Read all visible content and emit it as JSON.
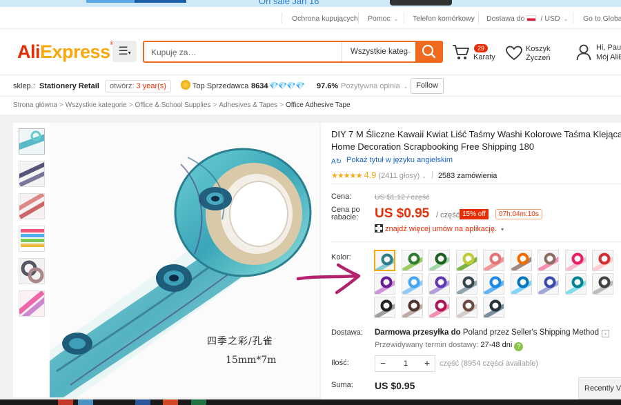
{
  "banner": {
    "text": "On sale Jan 16"
  },
  "topbar": {
    "links": [
      "Ochrona kupujących",
      "Pomoc",
      "Telefon komórkowy",
      "Dostawa do",
      "USD",
      "Go to Global"
    ],
    "separator": "/"
  },
  "header": {
    "logo_ali": "Ali",
    "logo_express": "Express",
    "logo_tm": "®",
    "search_placeholder": "Kupuję za…",
    "search_category": "Wszystkie kateg",
    "cart_count": "29",
    "cart_label": "Karaty",
    "wishlist_line1": "Koszyk",
    "wishlist_line2": "Życzeń",
    "user_line1": "Hi, Paul",
    "user_line2": "Mój AliE"
  },
  "store": {
    "label": "sklep.:",
    "name": "Stationery Retail",
    "open_label": "otwórz:",
    "open_value": "3 year(s)",
    "top_seller": "Top Sprzedawca",
    "score": "8634",
    "diamonds": "💎💎💎💎",
    "positive_pct": "97.6%",
    "positive_label": "Pozytywna opinia",
    "follow": "Follow"
  },
  "breadcrumbs": [
    "Strona główna",
    "Wszystkie kategorie",
    "Office & School Supplies",
    "Adhesives & Tapes",
    "Office Adhesive Tape"
  ],
  "product": {
    "title_line1": "DIY 7 M Śliczne Kawaii Kwiat Liść Taśmy Washi Kolorowe Taśma Klejąca D",
    "title_line2": "Home Decoration Scrapbooking Free Shipping 180",
    "translate": "Pokaż tytuł w języku angielskim",
    "stars": "★★★★★",
    "rating": "4.9",
    "votes": "(2411 głosy)",
    "orders": "2583 zamówienia",
    "price_label": "Cena:",
    "old_price": "US $1.12 / część",
    "discount_label_1": "Cena po",
    "discount_label_2": "rabacie:",
    "price": "US $0.95",
    "per_piece": "/ część",
    "off": "15% off",
    "timer": "07h:04m:10s",
    "app_deals": "znajdź więcej umów na aplikację.",
    "color_label": "Kolor:",
    "shipping_label": "Dostawa:",
    "shipping_bold": "Darmowa przesyłka do",
    "shipping_rest": "Poland przez Seller's Shipping Method",
    "delivery_label": "Przewidywany termin dostawy:",
    "delivery_days": "27-48 dni",
    "qty_label": "Ilość:",
    "qty_minus": "−",
    "qty_value": "1",
    "qty_plus": "+",
    "qty_info": "część (8954 części available)",
    "total_label": "Suma:",
    "total": "US $0.95",
    "image_text_1": "四季之彩/孔雀",
    "image_text_2": "15mm*7m"
  },
  "recently_viewed": "Recently V",
  "colors": {
    "brand_red": "#e62e04",
    "brand_orange": "#f7a80e",
    "search_orange": "#f06a1e",
    "arrow": "#b3236e"
  },
  "swatches": [
    {
      "c1": "#2f7d8a",
      "c2": "#89c9d2"
    },
    {
      "c1": "#2e7d32",
      "c2": "#9ccc65"
    },
    {
      "c1": "#1b5e20",
      "c2": "#a5d6a7"
    },
    {
      "c1": "#c0ca33",
      "c2": "#7cb342"
    },
    {
      "c1": "#e57373",
      "c2": "#ef9a9a"
    },
    {
      "c1": "#ef6c00",
      "c2": "#a1887f"
    },
    {
      "c1": "#8d6e63",
      "c2": "#f48fb1"
    },
    {
      "c1": "#e91e63",
      "c2": "#f8bbd0"
    },
    {
      "c1": "#d32f2f",
      "c2": "#ffcdd2"
    },
    {
      "c1": "#6a1b9a",
      "c2": "#ce93d8"
    },
    {
      "c1": "#42a5f5",
      "c2": "#90caf9"
    },
    {
      "c1": "#5e35b1",
      "c2": "#b39ddb"
    },
    {
      "c1": "#37474f",
      "c2": "#90a4ae"
    },
    {
      "c1": "#1e88e5",
      "c2": "#64b5f6"
    },
    {
      "c1": "#0277bd",
      "c2": "#81d4fa"
    },
    {
      "c1": "#3949ab",
      "c2": "#9fa8da"
    },
    {
      "c1": "#00838f",
      "c2": "#80deea"
    },
    {
      "c1": "#424242",
      "c2": "#bdbdbd"
    },
    {
      "c1": "#212121",
      "c2": "#9e9e9e"
    },
    {
      "c1": "#4e342e",
      "c2": "#bcaaa4"
    },
    {
      "c1": "#ad1457",
      "c2": "#f48fb1"
    },
    {
      "c1": "#6d4c41",
      "c2": "#d7ccc8"
    },
    {
      "c1": "#263238",
      "c2": "#78909c"
    }
  ]
}
